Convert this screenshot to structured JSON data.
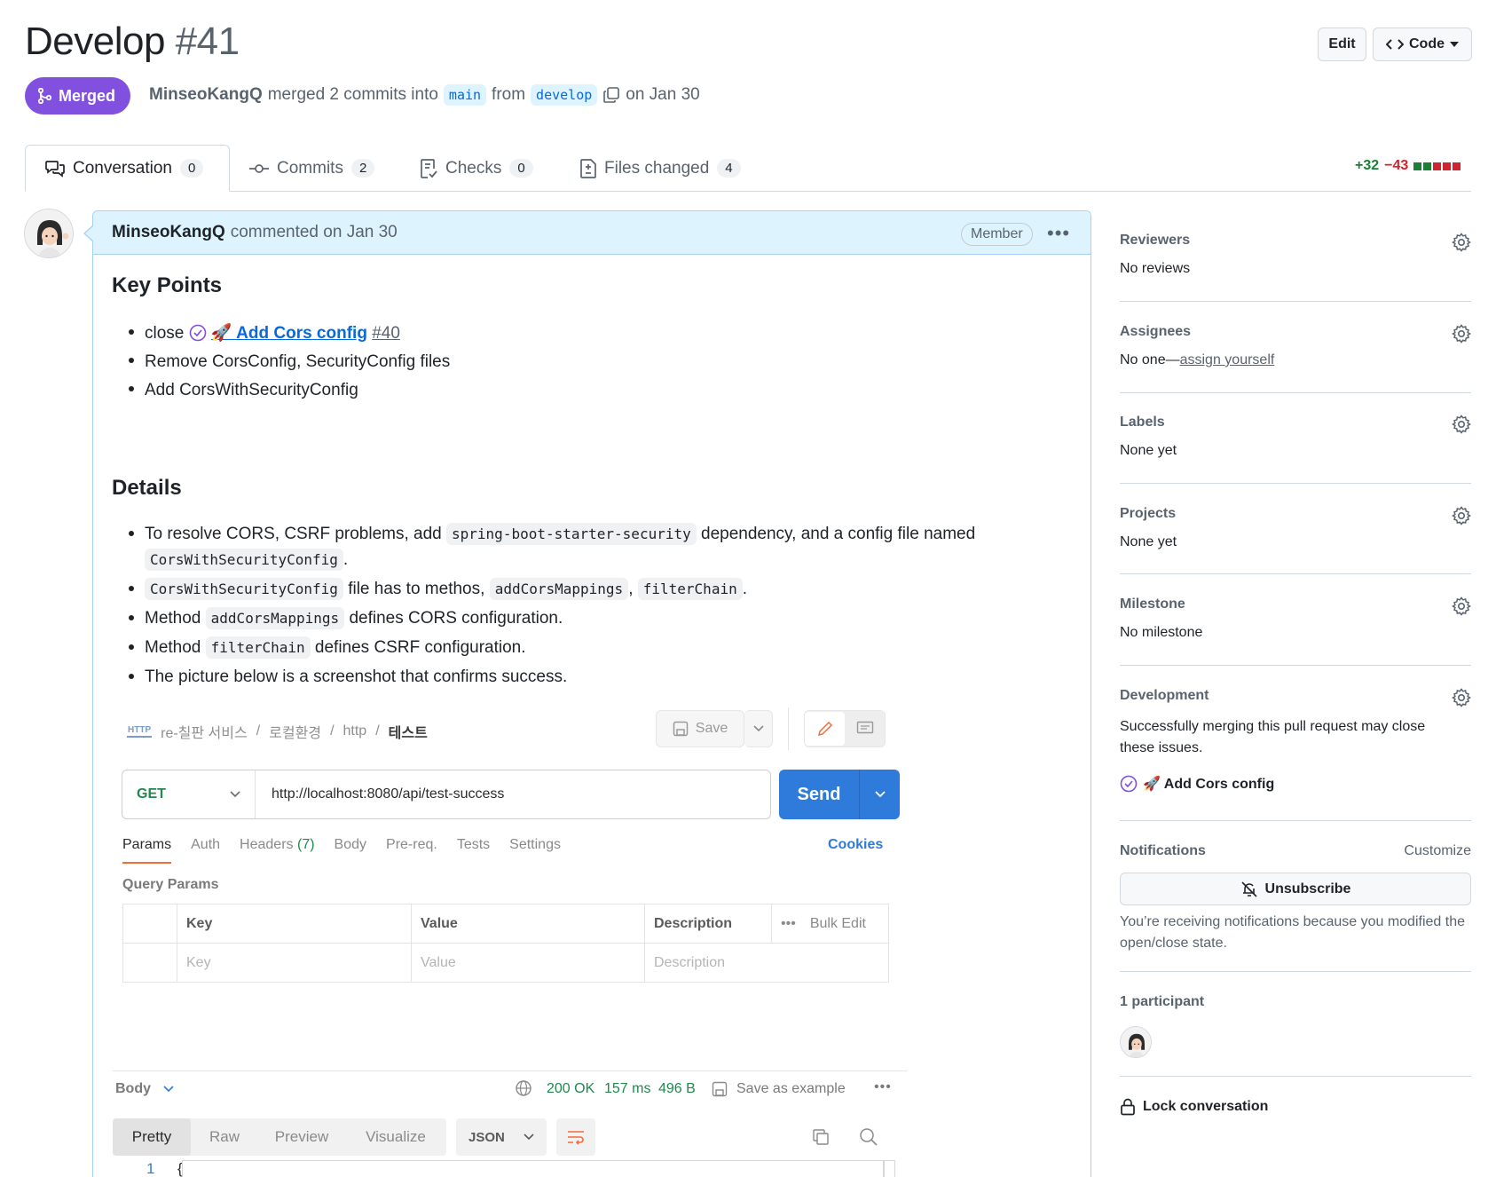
{
  "header": {
    "title": "Develop",
    "number": "#41",
    "edit_label": "Edit",
    "code_label": "Code"
  },
  "status": {
    "badge": "Merged",
    "author": "MinseoKangQ",
    "action": "merged 2 commits into",
    "base_branch": "main",
    "from": "from",
    "head_branch": "develop",
    "date": "on Jan 30"
  },
  "tabs": [
    {
      "label": "Conversation",
      "count": "0"
    },
    {
      "label": "Commits",
      "count": "2"
    },
    {
      "label": "Checks",
      "count": "0"
    },
    {
      "label": "Files changed",
      "count": "4"
    }
  ],
  "diffstat": {
    "additions": "+32",
    "deletions": "−43"
  },
  "comment": {
    "author": "MinseoKangQ",
    "meta": "commented on Jan 30",
    "role_badge": "Member",
    "key_points_heading": "Key Points",
    "kp1_prefix": "close",
    "kp1_link": "🚀 Add Cors config",
    "kp1_num": "#40",
    "kp2": "Remove CorsConfig, SecurityConfig files",
    "kp3": "Add CorsWithSecurityConfig",
    "details_heading": "Details",
    "d1_a": "To resolve CORS, CSRF problems, add",
    "d1_code": "spring-boot-starter-security",
    "d1_b": "dependency, and a config file named",
    "d1_code2": "CorsWithSecurityConfig",
    "d1_c": ".",
    "d2_code": "CorsWithSecurityConfig",
    "d2_a": "file has to methos,",
    "d2_code2": "addCorsMappings",
    "d2_b": ",",
    "d2_code3": "filterChain",
    "d2_c": ".",
    "d3_a": "Method",
    "d3_code": "addCorsMappings",
    "d3_b": "defines CORS configuration.",
    "d4_a": "Method",
    "d4_code": "filterChain",
    "d4_b": "defines CSRF configuration.",
    "d5": "The picture below is a screenshot that confirms success."
  },
  "postman": {
    "crumbs": [
      "re-칠판 서비스",
      "로컬환경",
      "http"
    ],
    "crumb_current": "테스트",
    "save_label": "Save",
    "method": "GET",
    "url": "http://localhost:8080/api/test-success",
    "send_label": "Send",
    "tabs": [
      "Params",
      "Auth",
      "Headers",
      "(7)",
      "Body",
      "Pre-req.",
      "Tests",
      "Settings"
    ],
    "cookies": "Cookies",
    "query_params_label": "Query Params",
    "columns": [
      "Key",
      "Value",
      "Description"
    ],
    "bulk_edit": "Bulk Edit",
    "placeholders": [
      "Key",
      "Value",
      "Description"
    ],
    "body_label": "Body",
    "status": "200 OK",
    "time": "157 ms",
    "size": "496 B",
    "save_example": "Save as example",
    "view_tabs": [
      "Pretty",
      "Raw",
      "Preview",
      "Visualize"
    ],
    "format": "JSON",
    "line_no": "1",
    "first_line": "{"
  },
  "sidebar": {
    "reviewers": {
      "title": "Reviewers",
      "value": "No reviews"
    },
    "assignees": {
      "title": "Assignees",
      "value": "No one—",
      "link": "assign yourself"
    },
    "labels": {
      "title": "Labels",
      "value": "None yet"
    },
    "projects": {
      "title": "Projects",
      "value": "None yet"
    },
    "milestone": {
      "title": "Milestone",
      "value": "No milestone"
    },
    "development": {
      "title": "Development",
      "value": "Successfully merging this pull request may close these issues.",
      "issue": "🚀 Add Cors config"
    },
    "notifications": {
      "title": "Notifications",
      "customize": "Customize",
      "unsubscribe": "Unsubscribe",
      "note": "You’re receiving notifications because you modified the open/close state."
    },
    "participants": {
      "title": "1 participant"
    },
    "lock": "Lock conversation"
  },
  "colors": {
    "merged": "#8250df",
    "link": "#0969da",
    "add": "#1a7f37",
    "del": "#d1242f",
    "send": "#2f7bdb"
  }
}
